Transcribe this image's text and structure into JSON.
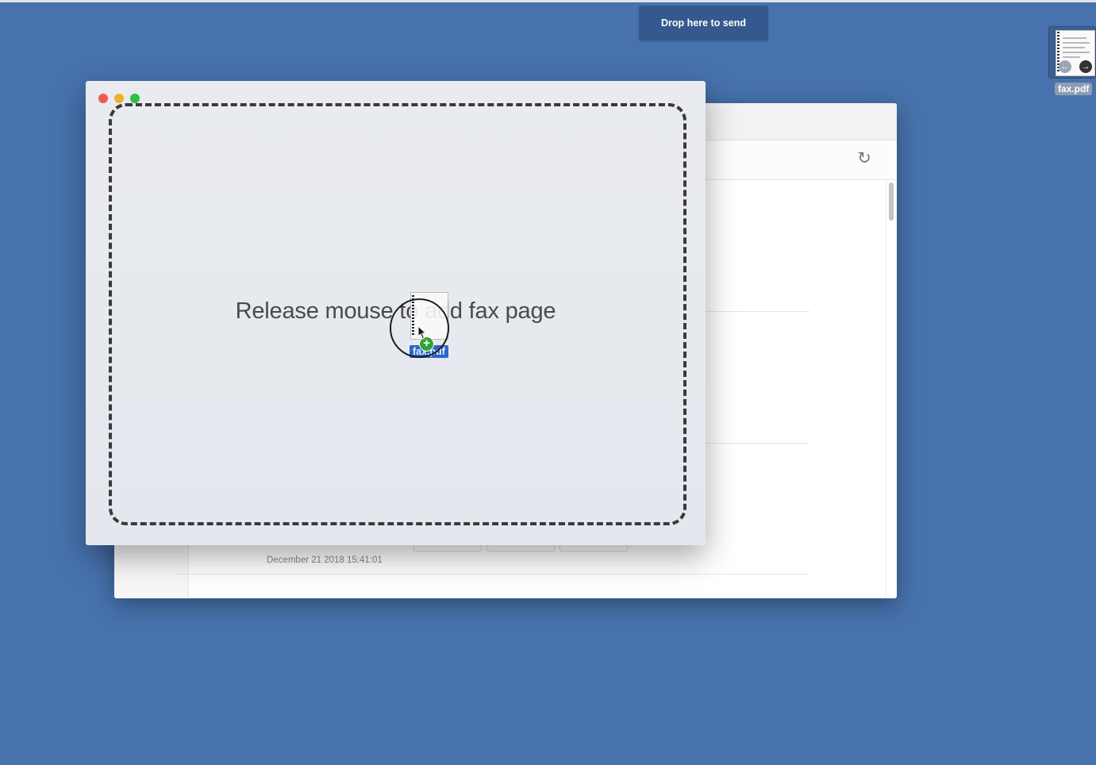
{
  "colors": {
    "desktop": "#4772ad",
    "banner": "#35598e",
    "traffic_red": "#ee5a52",
    "traffic_yellow": "#f1b02b",
    "traffic_green": "#2bc240",
    "drag_label": "#2c66c9",
    "plus_badge": "#2fa43a"
  },
  "banner": {
    "text": "Drop here to send"
  },
  "desktop_file": {
    "name": "fax.pdf",
    "icon": "pdf-document-icon"
  },
  "back_window": {
    "timestamp": "December 21 2018 15:41:01",
    "refresh_icon": "refresh-icon"
  },
  "drop_window": {
    "message": "Release mouse to add fax page"
  },
  "drag_item": {
    "name": "fax.pdf",
    "badge": "+"
  }
}
